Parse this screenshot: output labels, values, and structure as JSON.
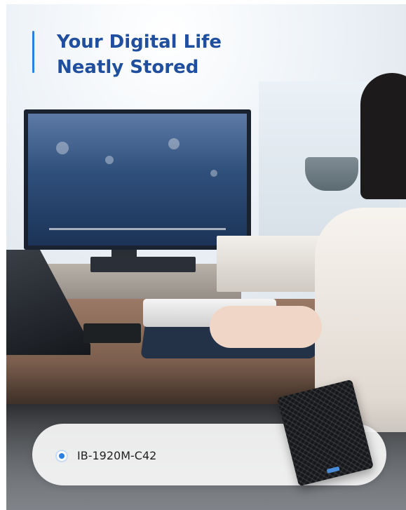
{
  "headline": {
    "line1": "Your Digital Life",
    "line2": "Neatly Stored"
  },
  "selector": {
    "model": "IB-1920M-C42",
    "selected": true
  },
  "colors": {
    "headline_text": "#1f4f9e",
    "accent": "#2c7fe3"
  },
  "icons": {
    "radio": "radio-selected-icon",
    "product": "external-ssd-enclosure"
  }
}
